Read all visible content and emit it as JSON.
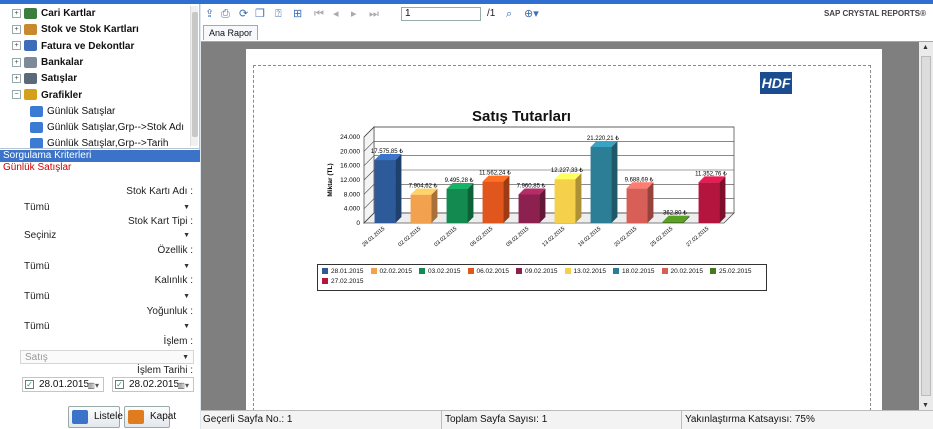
{
  "sidebar": {
    "tree": [
      {
        "label": "Cari Kartlar",
        "bold": true,
        "exp": "+",
        "color": "#3a7d3c"
      },
      {
        "label": "Stok ve Stok Kartları",
        "bold": true,
        "exp": "+",
        "color": "#c88a2e"
      },
      {
        "label": "Fatura ve Dekontlar",
        "bold": true,
        "exp": "+",
        "color": "#3d6cb8"
      },
      {
        "label": "Bankalar",
        "bold": true,
        "exp": "+",
        "color": "#7c8a99"
      },
      {
        "label": "Satışlar",
        "bold": true,
        "exp": "+",
        "color": "#5a6a7a"
      },
      {
        "label": "Grafikler",
        "bold": true,
        "exp": "−",
        "color": "#d4a019"
      },
      {
        "label": "Günlük Satışlar",
        "bold": false,
        "exp": "",
        "color": "#3b7bd4"
      },
      {
        "label": "Günlük Satışlar,Grp-->Stok Adı",
        "bold": false,
        "exp": "",
        "color": "#3b7bd4"
      },
      {
        "label": "Günlük Satışlar,Grp-->Tarih",
        "bold": false,
        "exp": "",
        "color": "#3b7bd4"
      }
    ],
    "criteria_header": "Sorgulama Kriterleri",
    "criteria_sub": "Günlük Satışlar",
    "fields": [
      {
        "label": "Stok Kartı Adı :",
        "value": "Tümü"
      },
      {
        "label": "Stok Kart Tipi :",
        "value": "Seçiniz"
      },
      {
        "label": "Özellik :",
        "value": "Tümü"
      },
      {
        "label": "Kalınlık :",
        "value": "Tümü"
      },
      {
        "label": "Yoğunluk :",
        "value": "Tümü"
      },
      {
        "label": "İşlem :",
        "value": "Satış"
      }
    ],
    "date_label": "İşlem Tarihi :",
    "date_from": "28.01.2015",
    "date_to": "28.02.2015",
    "list_button": "Listele",
    "close_button": "Kapat"
  },
  "toolbar": {
    "page_value": "1",
    "page_total": "/1",
    "brand": "SAP CRYSTAL REPORTS®",
    "tab": "Ana Rapor"
  },
  "report": {
    "logo": "HDF",
    "title": "Satış Tutarları"
  },
  "chart_data": {
    "type": "bar",
    "title": "Satış Tutarları",
    "ylabel": "Miktar (TL)",
    "ylim": [
      0,
      24000
    ],
    "yticks": [
      "0",
      "4.000",
      "8.000",
      "12.000",
      "16.000",
      "20.000",
      "24.000"
    ],
    "categories": [
      "28.01.2015",
      "02.02.2015",
      "03.02.2015",
      "06.02.2015",
      "09.02.2015",
      "13.02.2015",
      "18.02.2015",
      "20.02.2015",
      "25.02.2015",
      "27.02.2015"
    ],
    "values": [
      17575.85,
      7904.62,
      9495.28,
      11562.24,
      7960.85,
      12227.33,
      21220.21,
      9688.69,
      362.8,
      11352.76
    ],
    "data_labels": [
      "17.575,85 ₺",
      "7.904,62 ₺",
      "9.495,28 ₺",
      "11.562,24 ₺",
      "7.960,85 ₺",
      "12.227,33 ₺",
      "21.220,21 ₺",
      "9.688,69 ₺",
      "362,80 ₺",
      "11.352,76 ₺"
    ],
    "colors": [
      "#2d5b9a",
      "#f2a24e",
      "#138a4f",
      "#e0561c",
      "#8c2150",
      "#f5d04a",
      "#2b7e96",
      "#d85f57",
      "#447a1c",
      "#b4153f"
    ],
    "legend_position": "bottom",
    "grid": true
  },
  "status": {
    "current_page": "Geçerli Sayfa No.: 1",
    "total_pages": "Toplam Sayfa Sayısı: 1",
    "zoom": "Yakınlaştırma Katsayısı: 75%"
  }
}
